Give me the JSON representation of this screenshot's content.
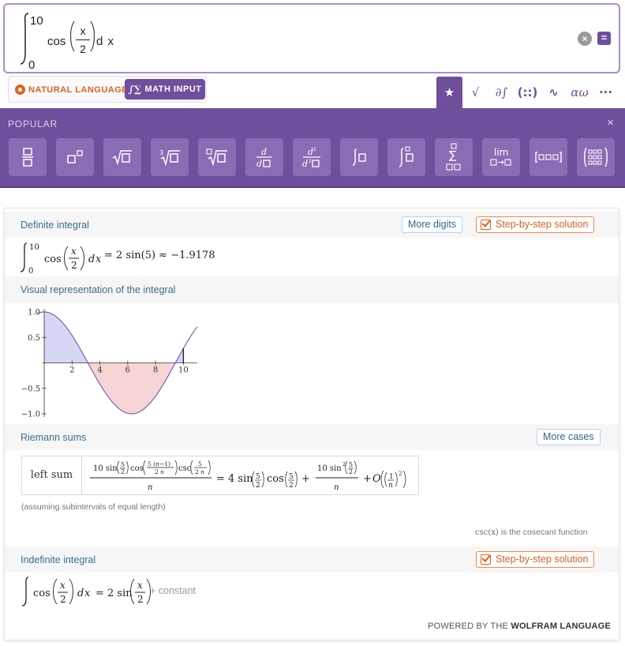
{
  "input": {
    "upper_limit": "10",
    "lower_limit": "0",
    "function": "cos",
    "numerator": "x",
    "denominator": "2",
    "differential": "d x"
  },
  "mode": {
    "natural_language": "NATURAL LANGUAGE",
    "math_input": "MATH INPUT"
  },
  "toolbar": {
    "icons": [
      "star-icon",
      "sqrt-icon",
      "partial-integral-icon",
      "matrix-icon",
      "wave-icon",
      "greek-icon",
      "more-icon"
    ],
    "labels": [
      "★",
      "√",
      "∂∫",
      "(::)",
      "∿",
      "αω",
      "···"
    ]
  },
  "palette": {
    "title": "POPULAR",
    "close": "×",
    "buttons": [
      "fraction",
      "superscript",
      "square root",
      "cube root",
      "nth root",
      "derivative",
      "second derivative",
      "integral",
      "definite integral",
      "sum",
      "limit",
      "vector",
      "matrix"
    ]
  },
  "pods": {
    "definite": {
      "title": "Definite integral",
      "more_digits": "More digits",
      "step_by_step": "Step-by-step solution",
      "result": "= 2 sin(5) ≈ −1.9178"
    },
    "visual": {
      "title": "Visual representation of the integral"
    },
    "riemann": {
      "title": "Riemann sums",
      "more_cases": "More cases",
      "row_label": "left sum",
      "assumption": "(assuming subintervals of equal length)",
      "csc_note": "is the cosecant function",
      "csc_expr": "csc(x)"
    },
    "indefinite": {
      "title": "Indefinite integral",
      "step_by_step": "Step-by-step solution",
      "constant": "+ constant"
    }
  },
  "footer": {
    "powered_prefix": "POWERED BY THE",
    "powered_brand": "WOLFRAM LANGUAGE"
  },
  "chart_data": {
    "type": "area",
    "function": "cos(x/2)",
    "x_range": [
      0,
      10
    ],
    "xlim": [
      -0.5,
      11
    ],
    "ylim": [
      -1.0,
      1.0
    ],
    "x_ticks": [
      2,
      4,
      6,
      8,
      10
    ],
    "y_ticks": [
      1.0,
      0.5,
      -0.5,
      -1.0
    ],
    "x_tick_labels": [
      "2",
      "4",
      "6",
      "8",
      "10"
    ],
    "y_tick_labels": [
      "1.0",
      "0.5",
      "−0.5",
      "−1.0"
    ],
    "positive_fill": "#d6d6f5",
    "negative_fill": "#f7d4d6",
    "curve_color": "#5b4db0"
  },
  "colors": {
    "accent": "#6f4e9c",
    "pod_title": "#3c6d8c",
    "step_orange": "#dd5f1a"
  }
}
